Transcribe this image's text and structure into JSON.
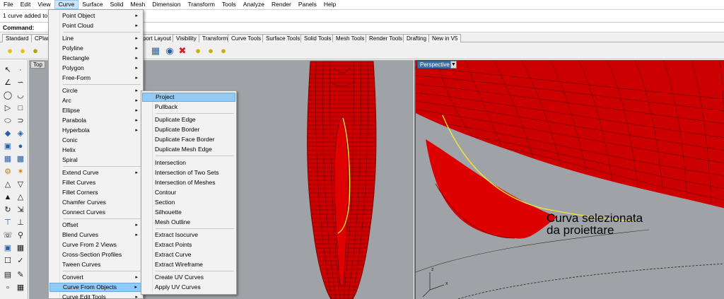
{
  "menubar": {
    "items": [
      "File",
      "Edit",
      "View",
      "Curve",
      "Surface",
      "Solid",
      "Mesh",
      "Dimension",
      "Transform",
      "Tools",
      "Analyze",
      "Render",
      "Panels",
      "Help"
    ],
    "active": "Curve"
  },
  "command": {
    "history": "1 curve added to s",
    "prompt": "Command:"
  },
  "tabs": [
    "Standard",
    "CPlan",
    "port Layout",
    "Visibility",
    "Transform",
    "Curve Tools",
    "Surface Tools",
    "Solid Tools",
    "Mesh Tools",
    "Render Tools",
    "Drafting",
    "New in V5"
  ],
  "viewports": {
    "top_label": "Top",
    "perspective_label": "Perspective"
  },
  "annotation": {
    "line1": "Curva selezionata",
    "line2": "da proiettare"
  },
  "curve_menu": {
    "items": [
      {
        "label": "Point Object",
        "submenu": true
      },
      {
        "label": "Point Cloud",
        "submenu": true
      },
      {
        "label": "Line",
        "submenu": true
      },
      {
        "label": "Polyline",
        "submenu": true
      },
      {
        "label": "Rectangle",
        "submenu": true
      },
      {
        "label": "Polygon",
        "submenu": true
      },
      {
        "label": "Free-Form",
        "submenu": true
      },
      {
        "label": "Circle",
        "submenu": true
      },
      {
        "label": "Arc",
        "submenu": true
      },
      {
        "label": "Ellipse",
        "submenu": true
      },
      {
        "label": "Parabola",
        "submenu": true
      },
      {
        "label": "Hyperbola",
        "submenu": true
      },
      {
        "label": "Conic",
        "submenu": false
      },
      {
        "label": "Helix",
        "submenu": false
      },
      {
        "label": "Spiral",
        "submenu": false
      },
      {
        "label": "Extend Curve",
        "submenu": true
      },
      {
        "label": "Fillet Curves",
        "submenu": false
      },
      {
        "label": "Fillet Corners",
        "submenu": false
      },
      {
        "label": "Chamfer Curves",
        "submenu": false
      },
      {
        "label": "Connect Curves",
        "submenu": false
      },
      {
        "label": "Offset",
        "submenu": true
      },
      {
        "label": "Blend Curves",
        "submenu": true
      },
      {
        "label": "Curve From 2 Views",
        "submenu": false
      },
      {
        "label": "Cross-Section Profiles",
        "submenu": false
      },
      {
        "label": "Tween Curves",
        "submenu": false
      },
      {
        "label": "Convert",
        "submenu": true
      },
      {
        "label": "Curve From Objects",
        "submenu": true
      },
      {
        "label": "Curve Edit Tools",
        "submenu": true
      }
    ],
    "highlighted": "Curve From Objects"
  },
  "submenu": {
    "items": [
      "Project",
      "Pullback",
      "Duplicate Edge",
      "Duplicate Border",
      "Duplicate Face Border",
      "Duplicate Mesh Edge",
      "Intersection",
      "Intersection of Two Sets",
      "Intersection of Meshes",
      "Contour",
      "Section",
      "Silhouette",
      "Mesh Outline",
      "Extract Isocurve",
      "Extract Points",
      "Extract Curve",
      "Extract Wireframe",
      "Create UV Curves",
      "Apply UV Curves"
    ],
    "highlighted": "Project"
  },
  "colors": {
    "hull_red": "#cc0000",
    "wire_dark": "#7a0000",
    "selection_yellow": "#f5e63a",
    "viewport_bg": "#9fa2a6",
    "menu_highlight": "#91c9f7"
  }
}
